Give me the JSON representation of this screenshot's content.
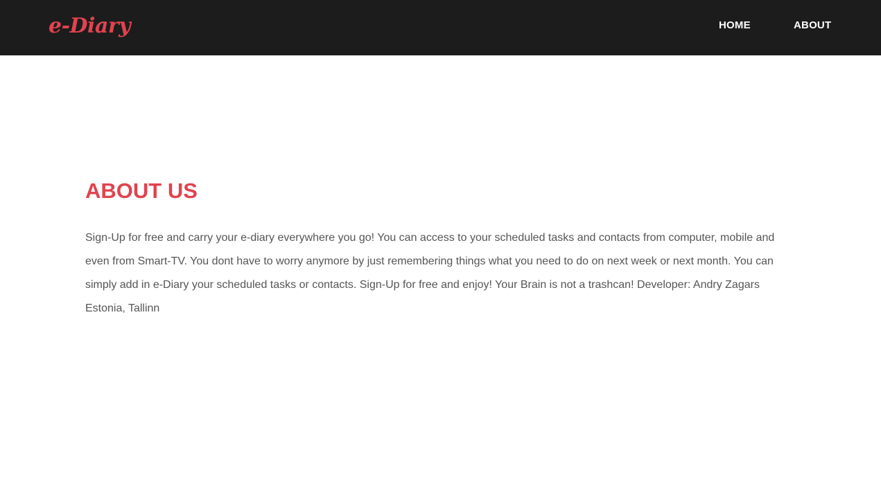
{
  "header": {
    "brand": "e-Diary",
    "nav": [
      {
        "label": "HOME"
      },
      {
        "label": "ABOUT"
      }
    ]
  },
  "about": {
    "title": "ABOUT US",
    "body": "Sign-Up for free and carry your e-diary everywhere you go! You can access to your scheduled tasks and contacts from computer, mobile and even from Smart-TV. You dont have to worry anymore by just remembering things what you need to do on next week or next month. You can simply add in e-Diary your scheduled tasks or contacts. Sign-Up for free and enjoy! Your Brain is not a trashcan! Developer: Andry Zagars Estonia, Tallinn"
  },
  "colors": {
    "navbar_bg": "#1c1c1c",
    "accent": "#e0434f",
    "body_text": "#555555",
    "nav_text": "#ffffff"
  }
}
